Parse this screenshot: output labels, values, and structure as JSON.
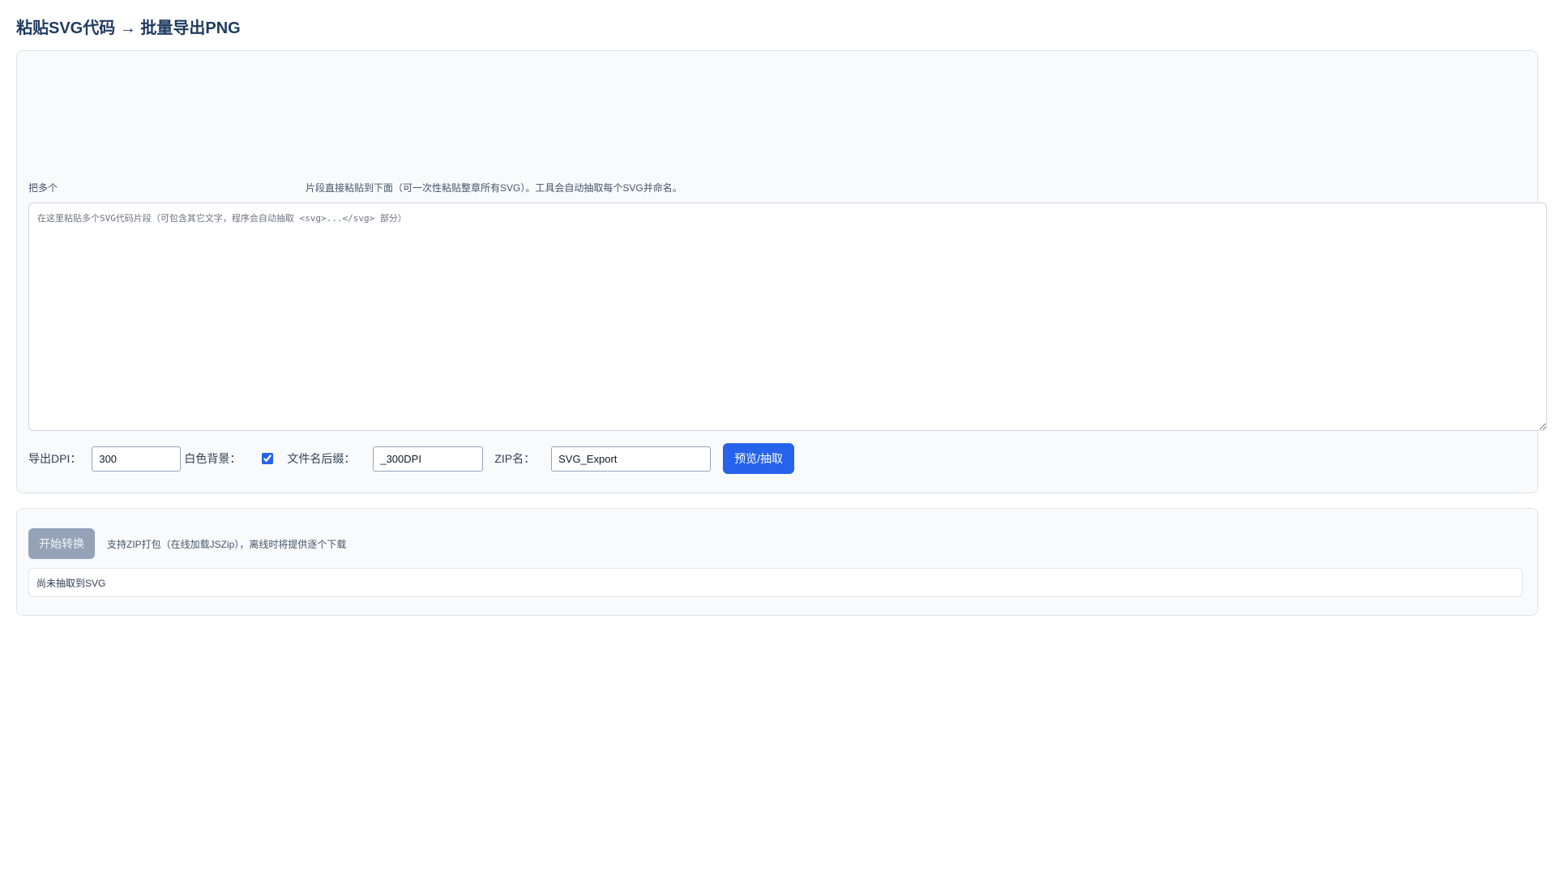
{
  "header": {
    "title": "粘贴SVG代码 → 批量导出PNG"
  },
  "input_panel": {
    "hint_prefix": "把多个",
    "hint_suffix": "片段直接粘贴到下面（可一次性粘贴整章所有SVG）。工具会自动抽取每个SVG并命名。",
    "textarea_value": "",
    "textarea_placeholder": "在这里粘贴多个SVG代码片段（可包含其它文字，程序会自动抽取 <svg>...</svg> 部分）"
  },
  "settings": {
    "dpi_label": "导出DPI：",
    "dpi_value": "300",
    "white_bg_label": "白色背景：",
    "white_bg_checked": true,
    "suffix_label": "文件名后缀：",
    "suffix_value": "_300DPI",
    "zip_label": "ZIP名：",
    "zip_value": "SVG_Export",
    "preview_button": "预览/抽取"
  },
  "convert_panel": {
    "start_button": "开始转换",
    "start_enabled": false,
    "zip_note": "支持ZIP打包（在线加载JSZip），离线时将提供逐个下载",
    "status_text": "尚未抽取到SVG"
  },
  "colors": {
    "accent": "#2563eb",
    "title": "#1e3a5f",
    "disabled_button": "#94a3b8",
    "card_background": "#f8fafc"
  }
}
